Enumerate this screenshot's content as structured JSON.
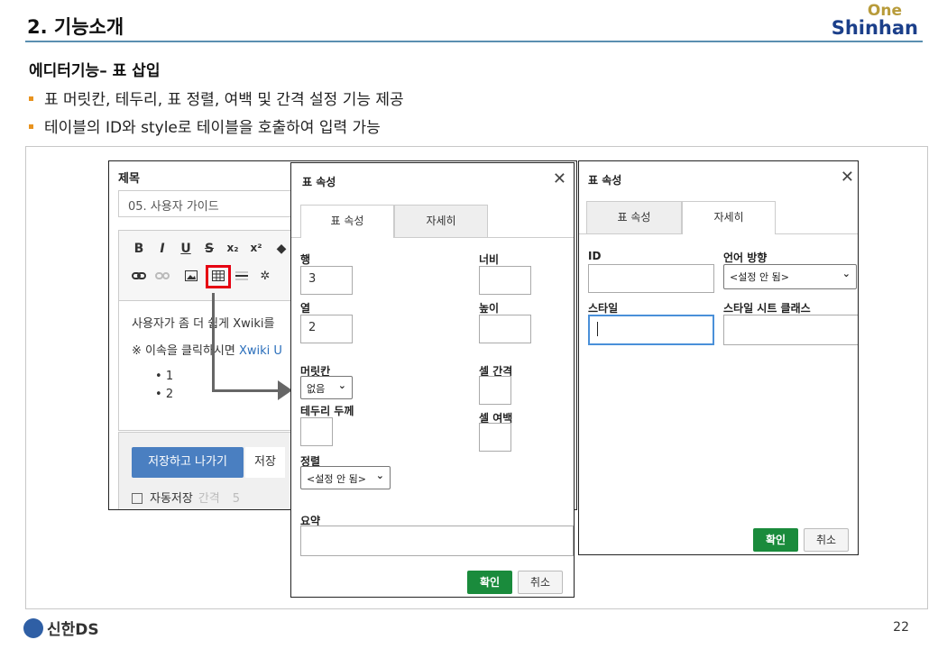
{
  "header": {
    "title": "2. 기능소개",
    "logo_top": "One",
    "logo_bottom": "Shinhan"
  },
  "section": {
    "title": "에디터기능– 표 삽입",
    "bullets": [
      "표 머릿칸, 테두리, 표 정렬, 여백 및 간격 설정 기능 제공",
      "테이블의 ID와 style로 테이블을 호출하여 입력 가능"
    ]
  },
  "editor": {
    "title_label": "제목",
    "title_value": "05. 사용자 가이드",
    "toolbar": {
      "bold": "B",
      "italic": "I",
      "underline": "U",
      "strike": "S",
      "subscript": "x₂",
      "superscript": "x²"
    },
    "content_line1": "사용자가 좀 더 쉽게 Xwiki를",
    "content_line2_prefix": "※ 이속을 클릭하시면",
    "content_line2_link": "Xwiki U",
    "list_items": [
      "1",
      "2"
    ],
    "save_exit_label": "저장하고 나가기",
    "save_label": "저장",
    "autosave_label": "자동저장",
    "autosave_interval_label": "간격",
    "autosave_interval_value": "5"
  },
  "dialog1": {
    "title": "표 속성",
    "tabs": [
      "표 속성",
      "자세히"
    ],
    "rows_label": "행",
    "rows_value": "3",
    "cols_label": "열",
    "cols_value": "2",
    "width_label": "너비",
    "height_label": "높이",
    "header_label": "머릿칸",
    "header_value": "없음",
    "border_label": "테두리 두께",
    "spacing_label": "셀 간격",
    "padding_label": "셀 여백",
    "align_label": "정렬",
    "align_value": "<설정 안 됨>",
    "summary_label": "요약",
    "ok_label": "확인",
    "cancel_label": "취소"
  },
  "dialog2": {
    "title": "표 속성",
    "tabs": [
      "표 속성",
      "자세히"
    ],
    "id_label": "ID",
    "lang_dir_label": "언어 방향",
    "lang_dir_value": "<설정 안 됨>",
    "style_label": "스타일",
    "stylesheet_label": "스타일 시트 클래스",
    "ok_label": "확인",
    "cancel_label": "취소"
  },
  "footer": {
    "company": "신한DS",
    "page_number": "22"
  },
  "colors": {
    "header_line": "#5a8fb0",
    "bullet": "#e8931f",
    "primary_button": "#4a7fc1",
    "ok_button": "#1a8b3c",
    "highlight": "#e60012",
    "link": "#2a6ebb"
  }
}
